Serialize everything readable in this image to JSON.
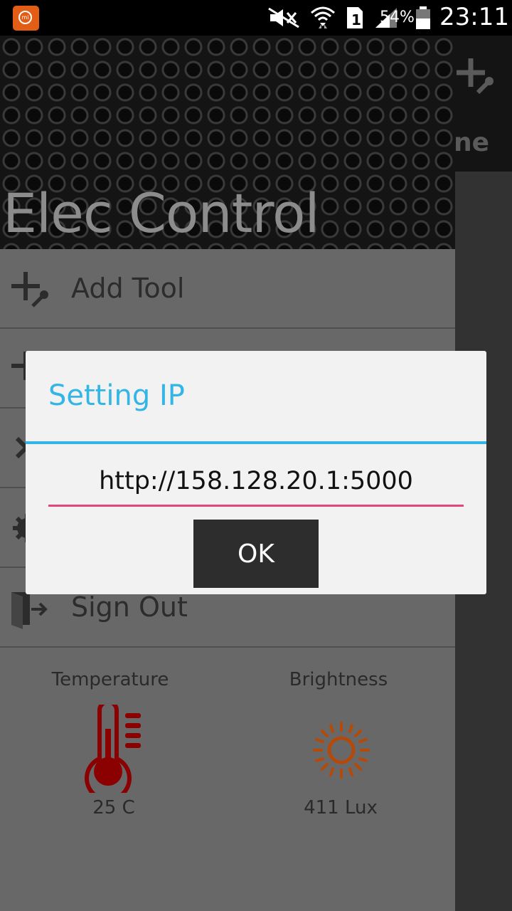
{
  "status_bar": {
    "battery_percent": "54%",
    "time": "23:11",
    "sim_slot": "1",
    "icons": [
      "mi-app-icon",
      "mute-icon",
      "wifi-icon",
      "sim-icon",
      "signal-icon",
      "battery-icon"
    ]
  },
  "drawer": {
    "title": "Elec Control",
    "menu_items": [
      {
        "label": "Add Tool",
        "icon": "add-tool-icon"
      },
      {
        "label": "",
        "icon": "add-icon"
      },
      {
        "label": "",
        "icon": "close-icon"
      },
      {
        "label": "",
        "icon": "gear-icon"
      },
      {
        "label": "Sign Out",
        "icon": "sign-out-icon"
      }
    ],
    "sensors": {
      "temperature": {
        "label": "Temperature",
        "value": "25 C",
        "icon": "thermometer-icon"
      },
      "brightness": {
        "label": "Brightness",
        "value": "411 Lux",
        "icon": "sun-icon"
      }
    }
  },
  "background_app": {
    "tab_text_partial": "ne"
  },
  "dialog": {
    "title": "Setting IP",
    "input_value": "http://158.128.20.1:5000",
    "ok_label": "OK"
  },
  "colors": {
    "accent_blue": "#33b5e5",
    "input_underline": "#e5457e",
    "thermometer": "#8b0000",
    "sun": "#b34a0b"
  }
}
